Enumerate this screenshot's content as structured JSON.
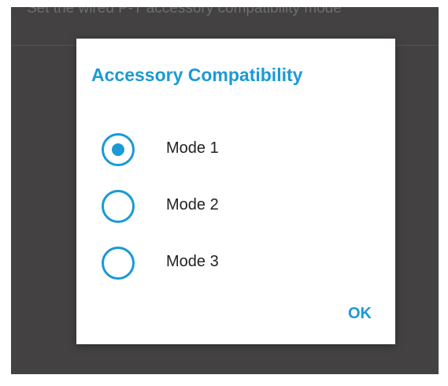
{
  "background": {
    "setting_summary": "Set the wired P-T accessory compatibility mode"
  },
  "dialog": {
    "title": "Accessory Compatibility",
    "options": [
      {
        "label": "Mode 1",
        "selected": true
      },
      {
        "label": "Mode 2",
        "selected": false
      },
      {
        "label": "Mode 3",
        "selected": false
      }
    ],
    "ok_label": "OK"
  },
  "colors": {
    "accent": "#1a9ad6",
    "scrim": "#434141",
    "dialog_background": "#ffffff",
    "label_text": "#222222"
  }
}
